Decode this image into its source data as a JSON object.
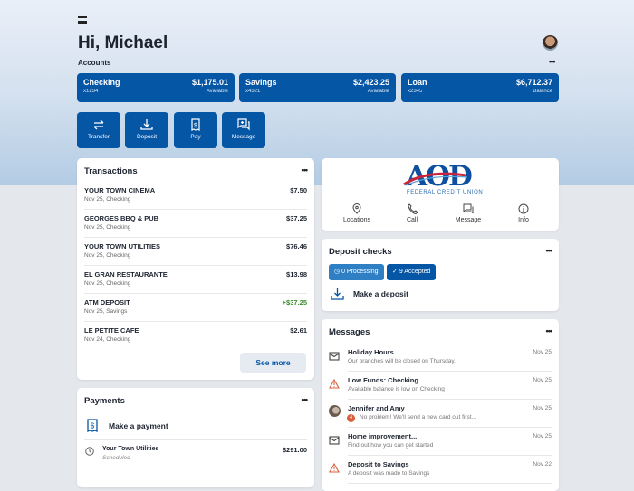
{
  "header": {
    "greeting": "Hi, Michael",
    "accounts_label": "Accounts"
  },
  "accounts": [
    {
      "name": "Checking",
      "number": "x1234",
      "amount": "$1,175.01",
      "status": "Available"
    },
    {
      "name": "Savings",
      "number": "x4321",
      "amount": "$2,423.25",
      "status": "Available"
    },
    {
      "name": "Loan",
      "number": "x2345",
      "amount": "$6,712.37",
      "status": "Balance"
    }
  ],
  "actions": [
    "Transfer",
    "Deposit",
    "Pay",
    "Message"
  ],
  "transactions": {
    "title": "Transactions",
    "see_more": "See more",
    "items": [
      {
        "name": "YOUR TOWN CINEMA",
        "date": "Nov 25, Checking",
        "amount": "$7.50"
      },
      {
        "name": "GEORGES BBQ & PUB",
        "date": "Nov 25, Checking",
        "amount": "$37.25"
      },
      {
        "name": "YOUR TOWN UTILITIES",
        "date": "Nov 25, Checking",
        "amount": "$76.46"
      },
      {
        "name": "EL GRAN RESTAURANTE",
        "date": "Nov 25, Checking",
        "amount": "$13.98"
      },
      {
        "name": "ATM DEPOSIT",
        "date": "Nov 25, Savings",
        "amount": "+$37.25"
      },
      {
        "name": "LE PETITE CAFE",
        "date": "Nov 24, Checking",
        "amount": "$2.61"
      }
    ]
  },
  "payments": {
    "title": "Payments",
    "make": "Make a payment",
    "items": [
      {
        "name": "Your Town Utilities",
        "status": "Scheduled",
        "amount": "$291.00"
      }
    ]
  },
  "bank": {
    "logo": "AOD",
    "logo_sub": "FEDERAL CREDIT UNION",
    "links": [
      "Locations",
      "Call",
      "Message",
      "Info"
    ]
  },
  "deposit": {
    "title": "Deposit checks",
    "processing": "0 Processing",
    "accepted": "9 Accepted",
    "make": "Make a deposit"
  },
  "messages": {
    "title": "Messages",
    "items": [
      {
        "title": "Holiday Hours",
        "body": "Our branches will be closed on Thursday.",
        "date": "Nov 25",
        "icon": "mail-icon"
      },
      {
        "title": "Low Funds: Checking",
        "body": "Available balance is low on Checking",
        "date": "Nov 25",
        "icon": "warning-icon"
      },
      {
        "title": "Jennifer and Amy",
        "body": "No problem! We'll send a new card out first...",
        "date": "Nov 25",
        "icon": "avatar",
        "badge": "4"
      },
      {
        "title": "Home improvement...",
        "body": "Find out how you can get started",
        "date": "Nov 25",
        "icon": "mail-icon"
      },
      {
        "title": "Deposit to Savings",
        "body": "A deposit was made to Savings",
        "date": "Nov 22",
        "icon": "warning-icon"
      }
    ]
  },
  "colors": {
    "brand": "#0656a6",
    "positive": "#3a8a2a",
    "warning": "#d9603a"
  }
}
